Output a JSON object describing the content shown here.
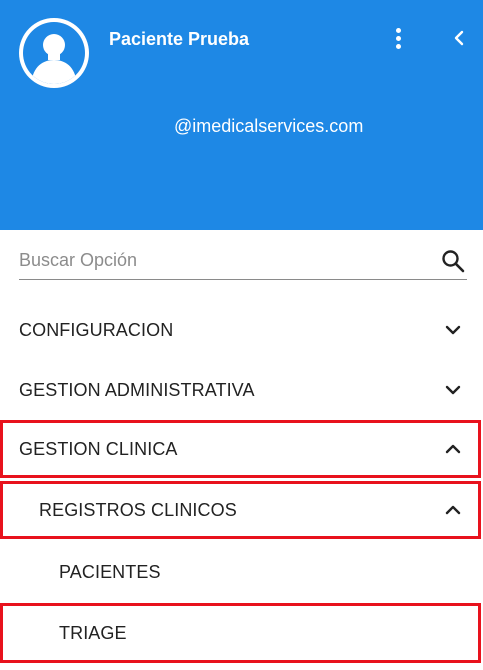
{
  "header": {
    "user_name": "Paciente Prueba",
    "user_email": "@imedicalservices.com",
    "background_color": "#1e88e5",
    "avatar_icon": "person-icon",
    "menu_icon": "more-vertical-icon",
    "back_icon": "chevron-left-icon"
  },
  "search": {
    "placeholder": "Buscar Opción",
    "value": "",
    "icon": "search-icon"
  },
  "menu": {
    "items": [
      {
        "label": "CONFIGURACION",
        "expanded": false,
        "icon": "chevron-down-icon"
      },
      {
        "label": "GESTION ADMINISTRATIVA",
        "expanded": false,
        "icon": "chevron-down-icon"
      },
      {
        "label": "GESTION CLINICA",
        "expanded": true,
        "icon": "chevron-up-icon",
        "highlighted": true
      },
      {
        "label": "REGISTROS CLINICOS",
        "expanded": true,
        "icon": "chevron-up-icon",
        "highlighted": true
      },
      {
        "label": "PACIENTES"
      },
      {
        "label": "TRIAGE",
        "highlighted": true
      }
    ]
  },
  "colors": {
    "accent": "#1e88e5",
    "highlight_border": "#e8121d",
    "text": "#222222"
  }
}
